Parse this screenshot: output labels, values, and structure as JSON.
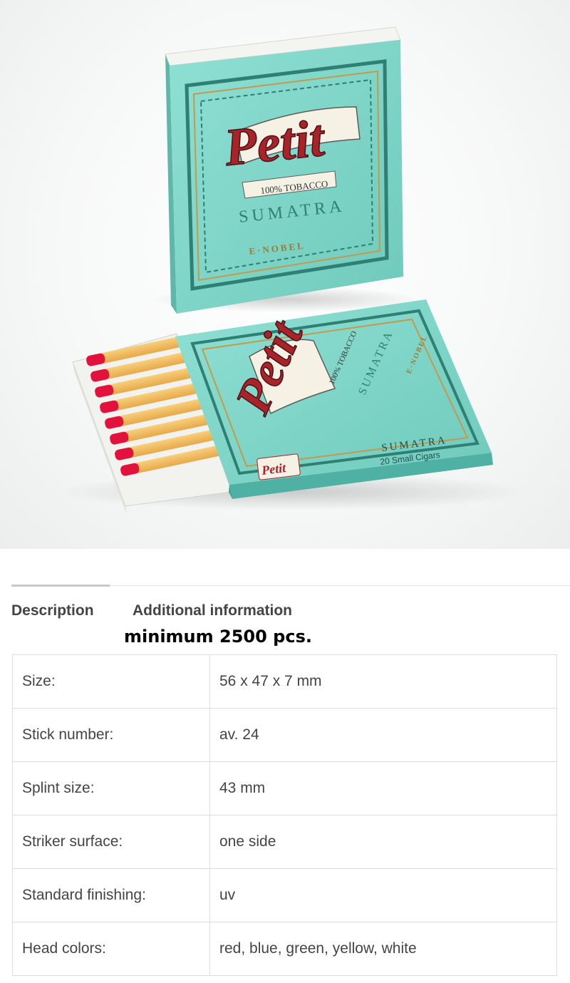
{
  "product": {
    "image_alt": "Petit Sumatra matchboxes",
    "box_text": {
      "brand": "Petit",
      "tagline": "100% TOBACCO",
      "variant": "SUMATRA",
      "maker": "E·NOBEL",
      "side_label": "20 Small Cigars"
    },
    "colors": {
      "box": "#7fd5c8",
      "box_dark": "#3e9d90",
      "brand_red": "#a8232a",
      "match_head": "#e3123d",
      "match_stick": "#f2b75a"
    }
  },
  "tabs": [
    {
      "label": "Description"
    },
    {
      "label": "Additional information"
    }
  ],
  "note": "minimum 2500 pcs.",
  "specs": [
    {
      "label": "Size:",
      "value": "56 x 47 x 7 mm"
    },
    {
      "label": "Stick number:",
      "value": "av. 24"
    },
    {
      "label": "Splint size:",
      "value": "43 mm"
    },
    {
      "label": "Striker surface:",
      "value": "one side"
    },
    {
      "label": "Standard finishing:",
      "value": "uv"
    },
    {
      "label": "Head colors:",
      "value": "red, blue, green, yellow, white"
    }
  ]
}
